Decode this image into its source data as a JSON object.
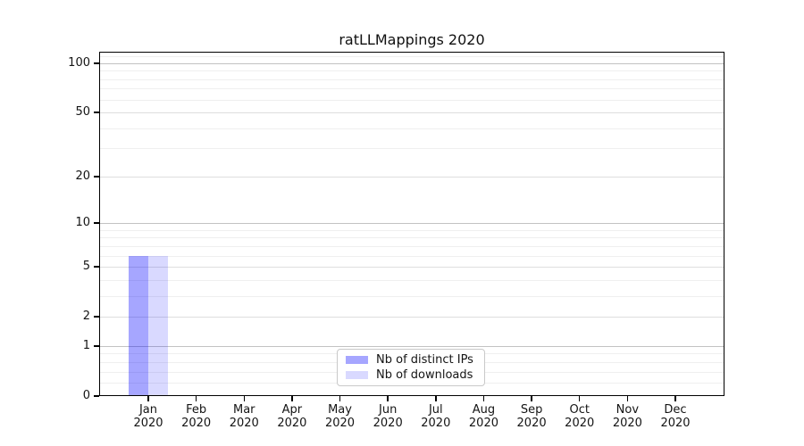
{
  "figure": {
    "title": "ratLLMappings 2020",
    "background": "#ffffff"
  },
  "colors": {
    "distinct_ips": "rgba(0,0,255,0.35)",
    "downloads": "rgba(0,0,255,0.15)",
    "distinct_ips_hex_on_white": "#a6a6ff",
    "downloads_hex_on_white": "#d9d9ff",
    "grid_decade": "#c2c2c2",
    "grid_major": "#dedede",
    "grid_minor": "#efefef",
    "axis_line": "#000000",
    "text": "#141414",
    "legend_border": "#c9c9c9"
  },
  "y_axis": {
    "scale": "symlog-like (log10(1+v))",
    "ticks": [
      {
        "value": 0,
        "label": "0"
      },
      {
        "value": 1,
        "label": "1"
      },
      {
        "value": 2,
        "label": "2"
      },
      {
        "value": 5,
        "label": "5"
      },
      {
        "value": 10,
        "label": "10"
      },
      {
        "value": 20,
        "label": "20"
      },
      {
        "value": 50,
        "label": "50"
      },
      {
        "value": 100,
        "label": "100"
      }
    ]
  },
  "legend": {
    "items": [
      {
        "label": "Nb of distinct IPs",
        "color_key": "distinct_ips"
      },
      {
        "label": "Nb of downloads",
        "color_key": "downloads"
      }
    ]
  },
  "chart_data": {
    "type": "bar",
    "title": "ratLLMappings 2020",
    "categories": [
      "Jan 2020",
      "Feb 2020",
      "Mar 2020",
      "Apr 2020",
      "May 2020",
      "Jun 2020",
      "Jul 2020",
      "Aug 2020",
      "Sep 2020",
      "Oct 2020",
      "Nov 2020",
      "Dec 2020"
    ],
    "series": [
      {
        "name": "Nb of distinct IPs",
        "values": [
          6,
          0,
          0,
          0,
          0,
          0,
          0,
          0,
          0,
          0,
          0,
          0
        ]
      },
      {
        "name": "Nb of downloads",
        "values": [
          6,
          0,
          0,
          0,
          0,
          0,
          0,
          0,
          0,
          0,
          0,
          0
        ]
      }
    ],
    "xlabel": "",
    "ylabel": "",
    "yticks": [
      0,
      1,
      2,
      5,
      10,
      20,
      50,
      100
    ],
    "ylim": [
      0,
      117
    ],
    "grid": true,
    "legend_position": "lower center"
  }
}
